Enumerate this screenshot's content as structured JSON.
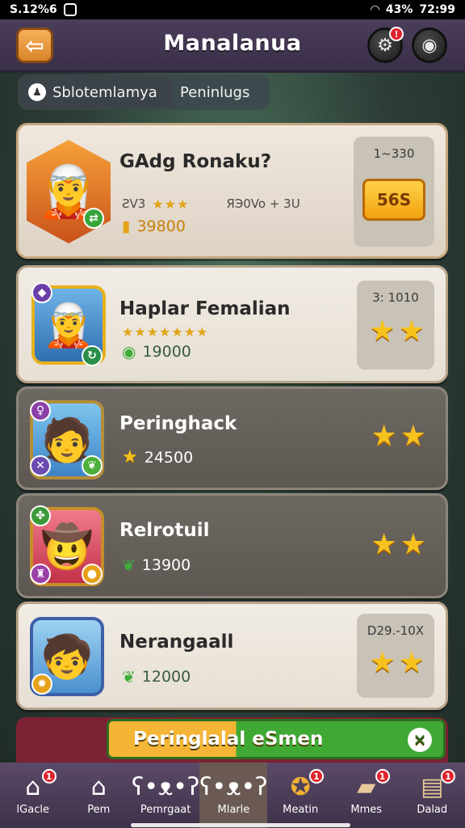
{
  "status_bar": {
    "time_left": "S.12%6",
    "battery": "43%",
    "time_right": "72:99"
  },
  "header": {
    "title": "Manalanua",
    "back_icon": "arrow-left-icon",
    "settings_badge": "!",
    "profile_icon": "ring-icon"
  },
  "tabs": [
    {
      "label": "Sblotemlamya",
      "icon": "person-icon",
      "active": true
    },
    {
      "label": "Peninlugs",
      "active": false
    }
  ],
  "featured": {
    "name": "GAdg Ronaku?",
    "level_text": "ƧV3",
    "range_text": "ЯЭ0Vo + 3U",
    "score": "39800",
    "panel_label": "1~330",
    "button_label": "56S"
  },
  "cards": [
    {
      "name": "Haplar Femalian",
      "score": "19000",
      "score_icon": "leaf-icon",
      "panel_label": "3: 1010",
      "stars": 2,
      "theme": "light"
    },
    {
      "name": "Peringhack",
      "score": "24500",
      "score_icon": "star-icon",
      "stars": 2,
      "theme": "dark"
    },
    {
      "name": "Relrotuil",
      "score": "13900",
      "score_icon": "leaf-icon",
      "stars": 2,
      "theme": "dark"
    },
    {
      "name": "Nerangaall",
      "score": "12000",
      "score_icon": "leaf-icon",
      "panel_label": "D29.-10X",
      "stars": 2,
      "theme": "light"
    }
  ],
  "banner": {
    "text": "Peringlalal eSmen",
    "close_icon": "close-icon"
  },
  "nav": [
    {
      "label": "lGacle",
      "icon": "house-icon",
      "badge": "1"
    },
    {
      "label": "Pem",
      "icon": "house-icon"
    },
    {
      "label": "Pemrgaat",
      "icon": "bear-icon"
    },
    {
      "label": "Mlarle",
      "icon": "bear-icon",
      "active": true
    },
    {
      "label": "Meatin",
      "icon": "gold-coin-icon",
      "badge": "1"
    },
    {
      "label": "Mmes",
      "icon": "card-icon",
      "badge": "1"
    },
    {
      "label": "Dalad",
      "icon": "scroll-icon",
      "badge": "1"
    }
  ]
}
